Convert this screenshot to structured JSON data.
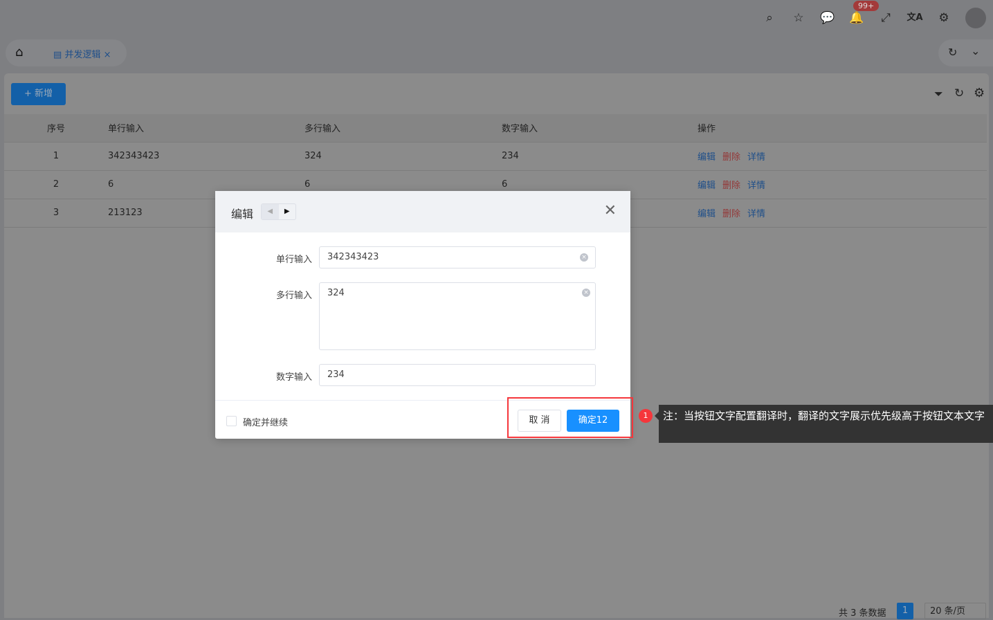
{
  "header": {
    "notification_count": "99+",
    "icons": [
      "search-icon",
      "star-icon",
      "message-icon",
      "bell-icon",
      "fullscreen-icon",
      "translate-icon",
      "gear-icon"
    ]
  },
  "tabs": [
    {
      "label": "并发逻辑",
      "close": "×"
    }
  ],
  "toolbar": {
    "add_label": "+ 新增"
  },
  "table": {
    "columns": [
      "序号",
      "单行输入",
      "多行输入",
      "数字输入",
      "操作"
    ],
    "rows": [
      {
        "index": "1",
        "single": "342343423",
        "multi": "324",
        "number": "234"
      },
      {
        "index": "2",
        "single": "6",
        "multi": "6",
        "number": "6"
      },
      {
        "index": "3",
        "single": "213123",
        "multi": "",
        "number": ""
      }
    ],
    "actions": {
      "edit": "编辑",
      "delete": "删除",
      "detail": "详情"
    }
  },
  "pagination": {
    "total": "共 3 条数据",
    "current": "1",
    "page_size": "20 条/页"
  },
  "modal": {
    "title": "编辑",
    "fields": [
      {
        "label": "单行输入",
        "value": "342343423"
      },
      {
        "label": "多行输入",
        "value": "324"
      },
      {
        "label": "数字输入",
        "value": "234"
      }
    ],
    "continue_label": "确定并继续",
    "cancel_label": "取 消",
    "confirm_label": "确定12"
  },
  "annotation": {
    "number": "1",
    "text": "注：当按钮文字配置翻译时，翻译的文字展示优先级高于按钮文本文字"
  },
  "colors": {
    "primary": "#1890ff",
    "annotation_red": "#f5363b"
  }
}
